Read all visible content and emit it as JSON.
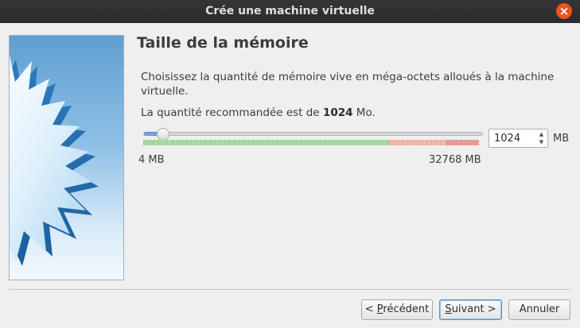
{
  "window": {
    "title": "Crée une machine virtuelle"
  },
  "page": {
    "heading": "Taille de la mémoire",
    "description": "Choisissez la quantité de mémoire vive en méga-octets alloués à la machine virtuelle.",
    "recommend_prefix": "La quantité recommandée est de ",
    "recommend_value": "1024",
    "recommend_suffix": " Mo."
  },
  "memory": {
    "value": "1024",
    "unit": "MB",
    "min_label": "4 MB",
    "max_label": "32768 MB",
    "min_mb": 4,
    "max_mb": 32768,
    "current_mb": 1024
  },
  "buttons": {
    "back_mnemonic": "< ",
    "back_underline": "P",
    "back_rest": "récédent",
    "next_underline": "S",
    "next_rest": "uivant >",
    "cancel": "Annuler"
  },
  "colors": {
    "accent": "#e95420",
    "scale_ok": "#a6dca3",
    "scale_warn": "#efb9ad",
    "scale_danger": "#ec9c9c"
  },
  "icons": {
    "close": "close-icon",
    "spin_up": "arrow-up-icon",
    "spin_down": "arrow-down-icon"
  }
}
